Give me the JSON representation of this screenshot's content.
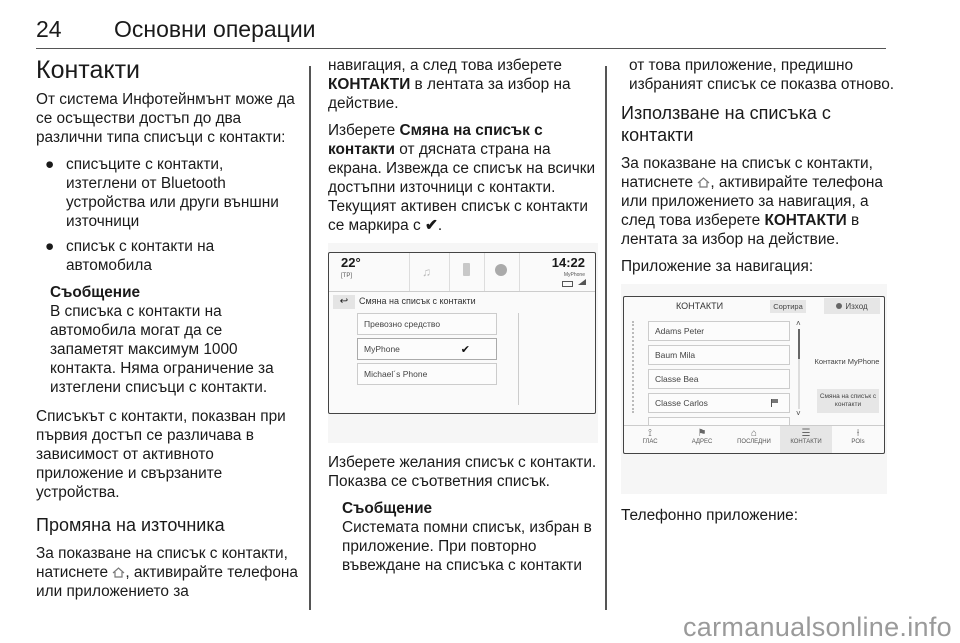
{
  "header": {
    "page_number": "24",
    "chapter_title": "Основни операции"
  },
  "col1": {
    "title": "Контакти",
    "intro": "От система Инфотейнмънт може да се осъществи достъп до два различни типа списъци с контакти:",
    "bullets": [
      "списъците с контакти, изтеглени от Bluetooth устройства или други външни източници",
      "списък с контакти на автомобила"
    ],
    "note_title": "Съобщение",
    "note_text": "В списъка с контакти на автомобила могат да се запаметят максимум 1000 контакта. Няма ограничение за изтеглени списъци с контакти.",
    "para2": "Списъкът с контакти, показван при първия достъп се различава в зависимост от активното приложение и свързаните устройства.",
    "section_title": "Промяна на източника",
    "para3_a": "За показване на списък с контакти, натиснете ",
    "para3_b": ", активирайте телефона или приложението за"
  },
  "col2": {
    "para1_a": "навигация, а след това изберете ",
    "para1_bold": "КОНТАКТИ",
    "para1_b": " в лентата за избор на действие.",
    "para2_a": "Изберете ",
    "para2_bold": "Смяна на списък с контакти",
    "para2_b": " от дясната страна на екрана. Извежда се списък на всички достъпни източници с контакти. Текущият активен списък с контакти се маркира с ",
    "para2_check": "✔",
    "para2_end": ".",
    "screenshot": {
      "temperature": "22°",
      "tp": "[TP]",
      "time": "14:22",
      "device": "MyPhone",
      "back_label": "↩",
      "title": "Смяна на списък с контакти",
      "items": [
        {
          "label": "Превозно средство",
          "checked": false
        },
        {
          "label": "MyPhone",
          "checked": true
        },
        {
          "label": "Michael´s Phone",
          "checked": false
        }
      ],
      "check_glyph": "✔"
    },
    "para3": "Изберете желания списък с контакти. Показва се съответния списък.",
    "note_title": "Съобщение",
    "note_text": "Системата помни списък, избран в приложение. При повторно въвеждане на списъка с контакти"
  },
  "col3": {
    "note_cont": "от това приложение, предишно избраният списък се показва отново.",
    "section_title": "Използване на списъка с контакти",
    "para1_a": "За показване на списък с контакти, натиснете ",
    "para1_b": ", активирайте телефона или приложението за навигация, а след това изберете ",
    "para1_bold": "КОНТАКТИ",
    "para1_c": " в лентата за избор на действие.",
    "nav_label": "Приложение за навигация:",
    "screenshot": {
      "title": "КОНТАКТИ",
      "sort_button": "Сортира",
      "exit_button": "Изход",
      "contacts": [
        "Adams Peter",
        "Baum Mila",
        "Classe Bea",
        "Classe Carlos"
      ],
      "side_label": "Контакти MyPhone",
      "change_button": "Смяна на списък с контакти",
      "tabs": [
        "ГЛАС",
        "АДРЕС",
        "ПОСЛЕДНИ",
        "КОНТАКТИ",
        "POIs"
      ],
      "active_tab": "КОНТАКТИ"
    },
    "phone_label": "Телефонно приложение:"
  },
  "watermark": "carmanualsonline.info"
}
